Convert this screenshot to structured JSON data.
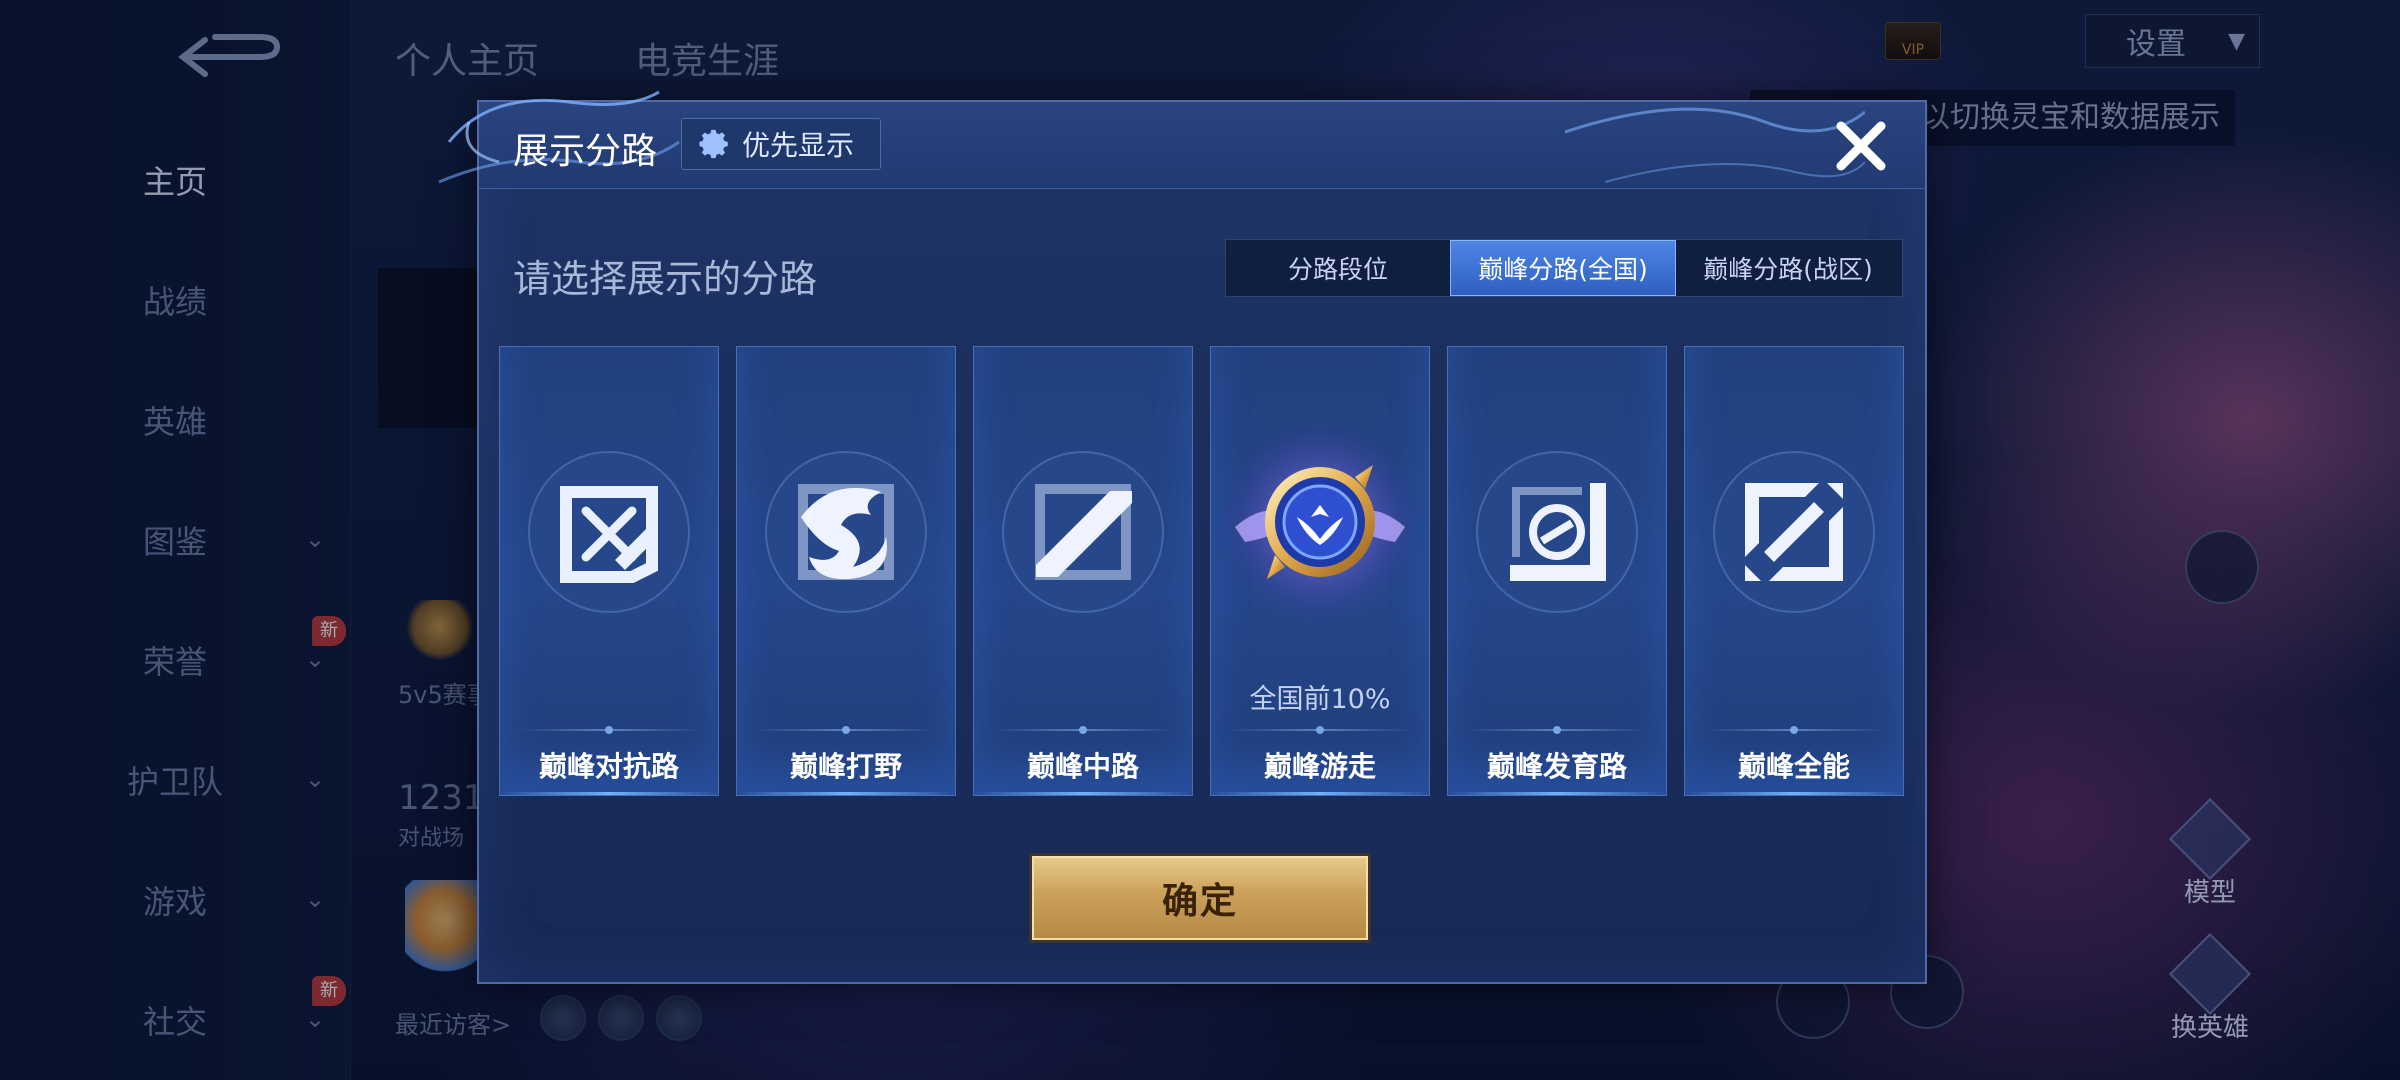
{
  "nav": {
    "items": [
      {
        "label": "主页",
        "active": true
      },
      {
        "label": "战绩"
      },
      {
        "label": "英雄"
      },
      {
        "label": "图鉴",
        "has_chevron": true
      },
      {
        "label": "荣誉",
        "has_chevron": true,
        "badge": "新"
      },
      {
        "label": "护卫队",
        "has_chevron": true
      },
      {
        "label": "游戏",
        "has_chevron": true
      },
      {
        "label": "社交",
        "has_chevron": true,
        "badge": "新"
      }
    ]
  },
  "top_tabs": [
    "个人主页",
    "电竞生涯"
  ],
  "background": {
    "text_5v5": "5v5赛事",
    "text_1231": "1231",
    "text_battles": "对战场",
    "recent_visitors": "最近访客>",
    "settings": "设置",
    "tip": "以切换灵宝和数据展示",
    "vip": "VIP",
    "model_btn": "模型",
    "swap_hero_btn": "换英雄"
  },
  "modal": {
    "title": "展示分路",
    "priority_button": "优先显示",
    "prompt": "请选择展示的分路",
    "segments": [
      {
        "label": "分路段位",
        "active": false
      },
      {
        "label": "巅峰分路(全国)",
        "active": true
      },
      {
        "label": "巅峰分路(战区)",
        "active": false
      }
    ],
    "cards": [
      {
        "label": "巅峰对抗路",
        "icon": "sword-cross-icon",
        "rank": "",
        "selected": false
      },
      {
        "label": "巅峰打野",
        "icon": "dragon-icon",
        "rank": "",
        "selected": false
      },
      {
        "label": "巅峰中路",
        "icon": "slash-bar-icon",
        "rank": "",
        "selected": false
      },
      {
        "label": "巅峰游走",
        "icon": "winged-emblem-icon",
        "rank": "全国前10%",
        "selected": true
      },
      {
        "label": "巅峰发育路",
        "icon": "bow-corner-icon",
        "rank": "",
        "selected": false
      },
      {
        "label": "巅峰全能",
        "icon": "all-round-icon",
        "rank": "",
        "selected": false
      }
    ],
    "confirm": "确定"
  },
  "colors": {
    "modal_bg": "#1d3262",
    "active_segment": "#3f74d6",
    "confirm_gold": "#caa05a",
    "card_bg": "#23427f"
  }
}
